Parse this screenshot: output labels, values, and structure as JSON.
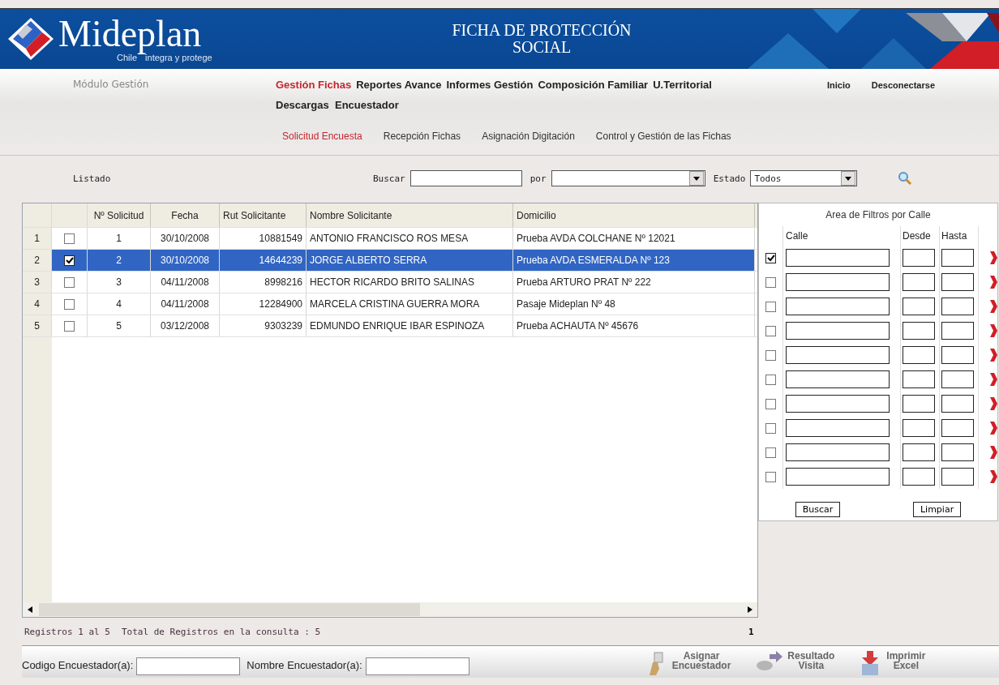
{
  "header": {
    "logo_text": "Mideplan",
    "tagline_country": "Chile",
    "tagline": "integra y protege",
    "title_lines": [
      "FICHA DE PROTECCIÓN",
      "SOCIAL"
    ]
  },
  "nav": {
    "module_label": "Módulo Gestión",
    "main_menu": [
      {
        "label": "Gestión Fichas",
        "selected": true
      },
      {
        "label": "Reportes Avance",
        "selected": false
      },
      {
        "label": "Informes Gestión",
        "selected": false
      },
      {
        "label": "Composición Familiar",
        "selected": false
      },
      {
        "label": "U.Territorial",
        "selected": false
      },
      {
        "label": "Descargas  Encuestador",
        "selected": false
      }
    ],
    "user_links": [
      "Inicio",
      "Desconectarse"
    ],
    "sub_menu": [
      {
        "label": "Solicitud Encuesta",
        "selected": true
      },
      {
        "label": "Recepción Fichas",
        "selected": false
      },
      {
        "label": "Asignación Digitación",
        "selected": false
      },
      {
        "label": "Control y Gestión de las Fichas",
        "selected": false
      }
    ]
  },
  "toolbar": {
    "list_label": "Listado",
    "search_label": "Buscar",
    "by_label": "por",
    "status_label": "Estado",
    "status_value": "Todos"
  },
  "grid": {
    "columns": [
      "Nº Solicitud",
      "Fecha",
      "Rut Solicitante",
      "Nombre Solicitante",
      "Domicilio"
    ],
    "rows": [
      {
        "row_number": "1",
        "checked": false,
        "selected": false,
        "cells": [
          "1",
          "30/10/2008",
          "10881549",
          "ANTONIO FRANCISCO ROS MESA",
          "Prueba AVDA COLCHANE Nº 12021"
        ]
      },
      {
        "row_number": "2",
        "checked": true,
        "selected": true,
        "cells": [
          "2",
          "30/10/2008",
          "14644239",
          "JORGE ALBERTO SERRA",
          "Prueba AVDA ESMERALDA Nº 123"
        ]
      },
      {
        "row_number": "3",
        "checked": false,
        "selected": false,
        "cells": [
          "3",
          "04/11/2008",
          "8998216",
          "HECTOR RICARDO BRITO SALINAS",
          "Prueba ARTURO PRAT Nº 222"
        ]
      },
      {
        "row_number": "4",
        "checked": false,
        "selected": false,
        "cells": [
          "4",
          "04/11/2008",
          "12284900",
          "MARCELA CRISTINA GUERRA MORA",
          "Pasaje Mideplan Nº 48"
        ]
      },
      {
        "row_number": "5",
        "checked": false,
        "selected": false,
        "cells": [
          "5",
          "03/12/2008",
          "9303239",
          "EDMUNDO ENRIQUE IBAR ESPINOZA",
          "Prueba ACHAUTA Nº 45676"
        ]
      }
    ]
  },
  "filter_panel": {
    "title": "Area de Filtros por Calle",
    "columns": [
      "Calle",
      "Desde",
      "Hasta"
    ],
    "rows": [
      {
        "checked": true
      },
      {
        "checked": false
      },
      {
        "checked": false
      },
      {
        "checked": false
      },
      {
        "checked": false
      },
      {
        "checked": false
      },
      {
        "checked": false
      },
      {
        "checked": false
      },
      {
        "checked": false
      },
      {
        "checked": false
      }
    ],
    "buttons": [
      "Buscar",
      "Limpiar"
    ]
  },
  "status": {
    "records": "Registros 1 al 5",
    "total": "Total de Registros en la consulta : 5",
    "page": "1"
  },
  "bottom": {
    "fields": [
      {
        "label": "Codigo Encuestador(a):"
      },
      {
        "label": "Nombre Encuestador(a):"
      }
    ],
    "actions": [
      {
        "kind": "assign",
        "lines": [
          "Asignar",
          "Encuestador"
        ]
      },
      {
        "kind": "result",
        "lines": [
          "Resultado",
          "Visita"
        ]
      },
      {
        "kind": "excel",
        "lines": [
          "Imprimir",
          "Excel"
        ]
      }
    ]
  }
}
